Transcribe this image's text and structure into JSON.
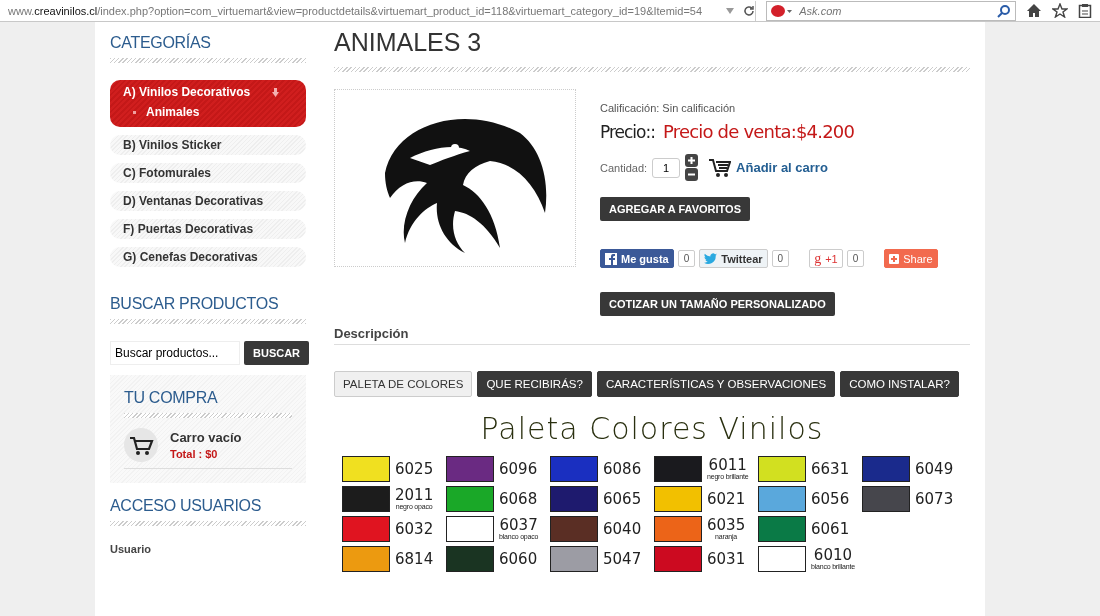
{
  "browser": {
    "url": "www.**creavinilos.cl**/index.php?option=com_virtuemart&view=productdetails&virtuemart_product_id=118&virtuemart_category_id=19&Itemid=54",
    "search": {
      "placeholder": "Ask.com"
    }
  },
  "sidebar": {
    "categories_title": "CATEGORÍAS",
    "categories": [
      {
        "label": "A) Vinilos Decorativos",
        "selected": true,
        "expanded": true,
        "children": [
          {
            "label": "Animales"
          }
        ]
      },
      {
        "label": "B) Vinilos Sticker",
        "selected": false,
        "expanded": false
      },
      {
        "label": "C) Fotomurales",
        "selected": false,
        "expanded": false
      },
      {
        "label": "D) Ventanas Decorativas",
        "selected": false,
        "expanded": false
      },
      {
        "label": "F) Puertas Decorativas",
        "selected": false,
        "expanded": false
      },
      {
        "label": "G) Cenefas Decorativas",
        "selected": false,
        "expanded": false
      }
    ],
    "search_title": "BUSCAR PRODUCTOS",
    "search": {
      "value": "Buscar productos...",
      "button": "BUSCAR"
    },
    "cart": {
      "title": "TU COMPRA",
      "status": "Carro vacío",
      "total": "Total : $0"
    },
    "login_title": "ACCESO USUARIOS",
    "login_label": "Usuario"
  },
  "product": {
    "title": "ANIMALES 3",
    "rating": "Calificación: Sin calificación",
    "price_label": "Precio::",
    "price": "Precio de venta:$4.200",
    "quantity_label": "Cantidad:",
    "quantity": "1",
    "add_to_cart": "Añadir al carro",
    "favorites_button": "AGREGAR A FAVORITOS",
    "social": [
      {
        "kind": "facebook",
        "label": "Me gusta",
        "count": "0"
      },
      {
        "kind": "twitter",
        "label": "Twittear",
        "count": "0"
      },
      {
        "kind": "gplus",
        "glyph": "g",
        "label": "+1",
        "count": "0"
      },
      {
        "kind": "share",
        "label": "Share"
      }
    ],
    "quote_button": "COTIZAR UN TAMAÑO PERSONALIZADO"
  },
  "description": {
    "title": "Descripción",
    "tabs": [
      {
        "label": "PALETA DE COLORES",
        "selected": true
      },
      {
        "label": "QUE RECIBIRÁS?",
        "selected": false
      },
      {
        "label": "CARACTERÍSTICAS Y OBSERVACIONES",
        "selected": false
      },
      {
        "label": "COMO INSTALAR?",
        "selected": false
      }
    ],
    "palette_title": "Paleta Colores Vinilos",
    "palette": [
      [
        {
          "code": "6025",
          "color": "#f0e020"
        },
        {
          "code": "6096",
          "color": "#6a2a82"
        },
        {
          "code": "6086",
          "color": "#1a2fc0"
        },
        {
          "code": "6011",
          "note": "negro brillante",
          "color": "#1a1a1e"
        },
        {
          "code": "6631",
          "color": "#d2e020"
        },
        {
          "code": "6049",
          "color": "#1a2a8c"
        }
      ],
      [
        {
          "code": "2011",
          "note": "negro opaco",
          "color": "#1c1c1c"
        },
        {
          "code": "6068",
          "color": "#1aa828"
        },
        {
          "code": "6065",
          "color": "#1e1a6e"
        },
        {
          "code": "6021",
          "color": "#f2c000"
        },
        {
          "code": "6056",
          "color": "#5aa8dc"
        },
        {
          "code": "6073",
          "color": "#46464c"
        }
      ],
      [
        {
          "code": "6032",
          "color": "#e01420"
        },
        {
          "code": "6037",
          "note": "blanco opaco",
          "color": "#ffffff"
        },
        {
          "code": "6040",
          "color": "#5a2e24"
        },
        {
          "code": "6035",
          "note": "naranja",
          "color": "#ec6418"
        },
        {
          "code": "6061",
          "color": "#0a7a46"
        }
      ],
      [
        {
          "code": "6814",
          "color": "#ec9a10"
        },
        {
          "code": "6060",
          "color": "#1a3422"
        },
        {
          "code": "5047",
          "color": "#9c9ca4"
        },
        {
          "code": "6031",
          "color": "#cc0a20"
        },
        {
          "code": "6010",
          "note": "blanco brillante",
          "color": "#ffffff"
        }
      ]
    ]
  }
}
